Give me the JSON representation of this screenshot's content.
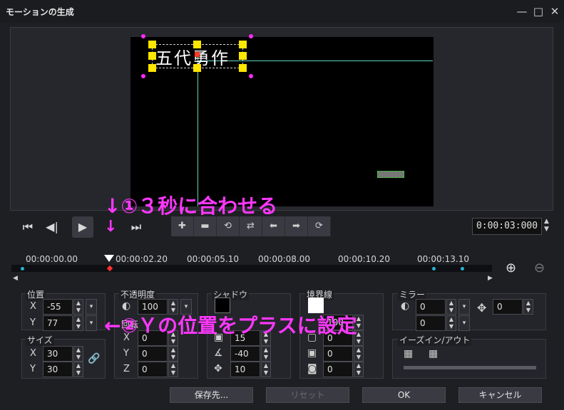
{
  "window": {
    "title": "モーションの生成",
    "min": "—",
    "max": "□",
    "close": "✕"
  },
  "preview": {
    "sample_text": "五代勇作"
  },
  "transport": {
    "start": "⏮",
    "prev": "◀|",
    "play": "▶",
    "next": "|▶",
    "end": "⏭",
    "timecode": "0:00:03:000"
  },
  "keyframe_tools": [
    "✚",
    "▬",
    "⟲",
    "⇄",
    "⬅",
    "➡",
    "⟳"
  ],
  "annotations": {
    "step1": "↓①３秒に合わせる",
    "step1_arrow": "↓",
    "step2": "←②Ｙの位置をプラスに設定"
  },
  "timeline": {
    "labels": [
      "00:00:00.00",
      "00:00:02.20",
      "00:00:05.10",
      "00:00:08.00",
      "00:00:10.20",
      "00:00:13.10"
    ],
    "zoom_in": "⊕",
    "zoom_out": "⊖",
    "scroll_left": "◀",
    "scroll_right": "▶"
  },
  "position": {
    "title": "位置",
    "x_label": "X",
    "y_label": "Y",
    "x": "-55",
    "y": "77"
  },
  "size": {
    "title": "サイズ",
    "x_label": "X",
    "y_label": "Y",
    "x": "30",
    "y": "30",
    "link": "🔗"
  },
  "opacity": {
    "title": "不透明度",
    "value": "100"
  },
  "rotation": {
    "title": "回転",
    "x_label": "X",
    "y_label": "Y",
    "z_label": "Z",
    "x": "0",
    "y": "0",
    "z": "0"
  },
  "shadow": {
    "title": "シャドウ",
    "v1": "15",
    "v2": "-40",
    "v3": "10",
    "color": "#000000"
  },
  "border": {
    "title": "境界線",
    "v1": "100",
    "v2": "0",
    "v3": "0",
    "v4": "0",
    "color": "#ffffff"
  },
  "mirror": {
    "title": "ミラー",
    "v1": "0",
    "v2": "0",
    "move": "0"
  },
  "ease": {
    "title": "イーズイン/アウト"
  },
  "buttons": {
    "save": "保存先...",
    "reset": "リセット",
    "ok": "OK",
    "cancel": "キャンセル"
  },
  "colors": {
    "accent": "#ff37ff",
    "bg": "#1e1f23"
  }
}
